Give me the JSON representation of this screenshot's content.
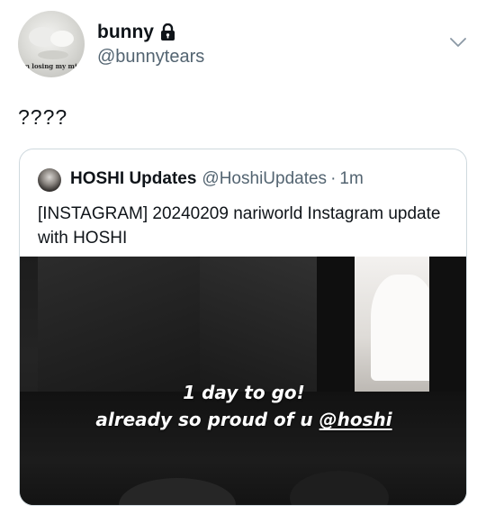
{
  "author": {
    "display_name": "bunny",
    "handle": "@bunnytears",
    "avatar_caption": "'m losing my min",
    "locked_icon": "lock-icon"
  },
  "menu_icon": "chevron-down-icon",
  "tweet": {
    "text": "????"
  },
  "quoted_tweet": {
    "display_name": "HOSHI Updates",
    "handle": "@HoshiUpdates",
    "separator": "·",
    "time": "1m",
    "text": "[INSTAGRAM] 20240209 nariworld Instagram update with HOSHI",
    "media": {
      "overlay_line1": "1 day to go!",
      "overlay_line2_prefix": "already so proud of u ",
      "overlay_mention": "@hoshi"
    }
  },
  "colors": {
    "text_primary": "#0f1419",
    "text_secondary": "#536471",
    "border": "#cfd9de"
  }
}
